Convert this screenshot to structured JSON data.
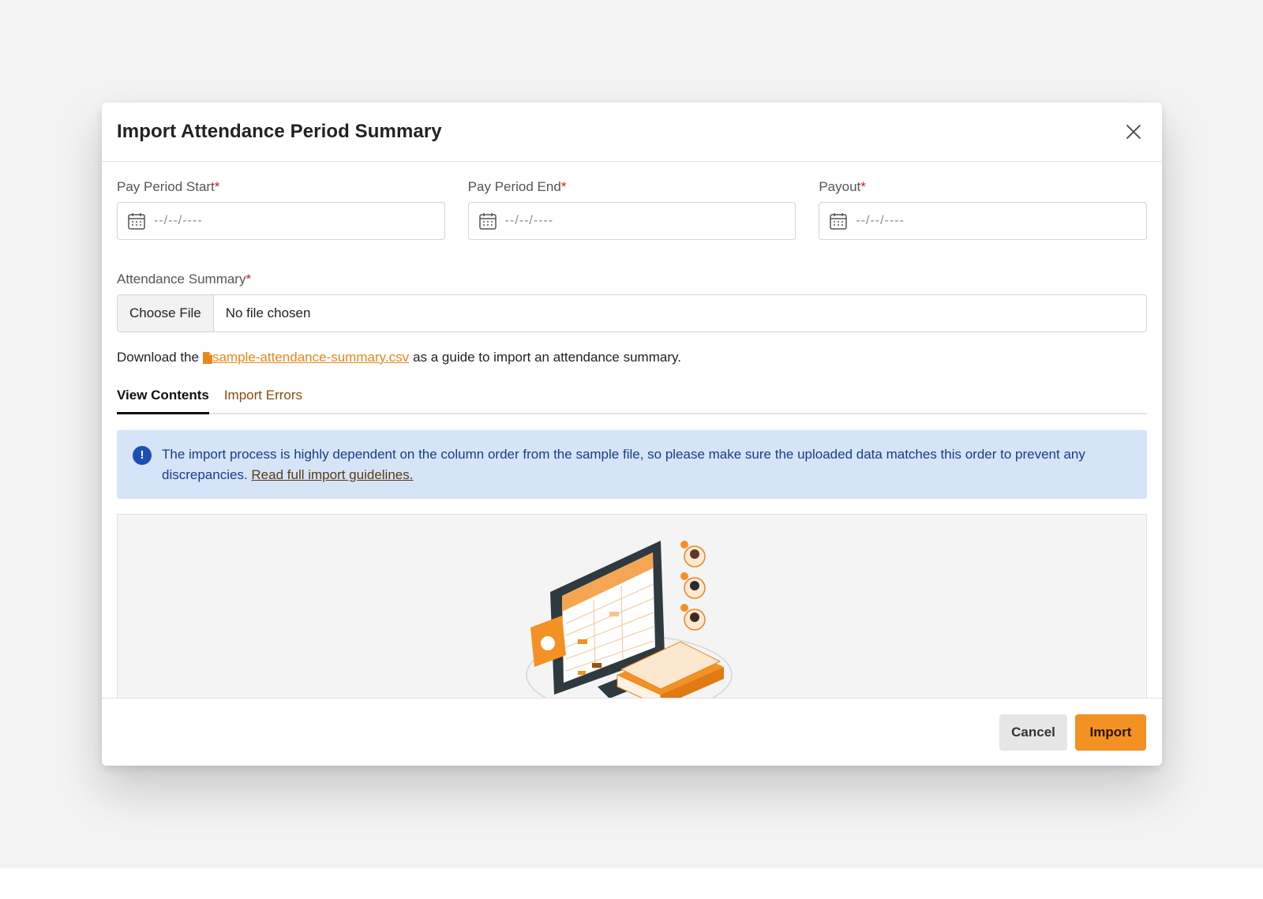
{
  "modal": {
    "title": "Import Attendance Period Summary"
  },
  "form": {
    "pay_period_start": {
      "label": "Pay Period Start",
      "required_mark": "*",
      "placeholder": "--/--/----"
    },
    "pay_period_end": {
      "label": "Pay Period End",
      "required_mark": "*",
      "placeholder": "--/--/----"
    },
    "payout": {
      "label": "Payout",
      "required_mark": "*",
      "placeholder": "--/--/----"
    },
    "attendance_summary": {
      "label": "Attendance Summary",
      "required_mark": "*",
      "button_label": "Choose File",
      "status": "No file chosen"
    }
  },
  "guide": {
    "prefix": "Download the",
    "link_text": "sample-attendance-summary.csv",
    "suffix": "as a guide to import an attendance summary."
  },
  "tabs": [
    {
      "label": "View Contents",
      "active": true
    },
    {
      "label": "Import Errors",
      "active": false
    }
  ],
  "alert": {
    "message": "The import process is highly dependent on the column order from the sample file, so please make sure the uploaded data matches this order to prevent any discrepancies.",
    "link_text": "Read full import guidelines."
  },
  "footer": {
    "cancel_label": "Cancel",
    "import_label": "Import"
  },
  "colors": {
    "accent": "#f39124",
    "link": "#e8861a",
    "info_bg": "#d6e4f8",
    "info_text": "#163e8a",
    "required": "#d11a1a"
  },
  "icons": [
    "close-icon",
    "calendar-icon",
    "file-icon",
    "info-icon"
  ]
}
